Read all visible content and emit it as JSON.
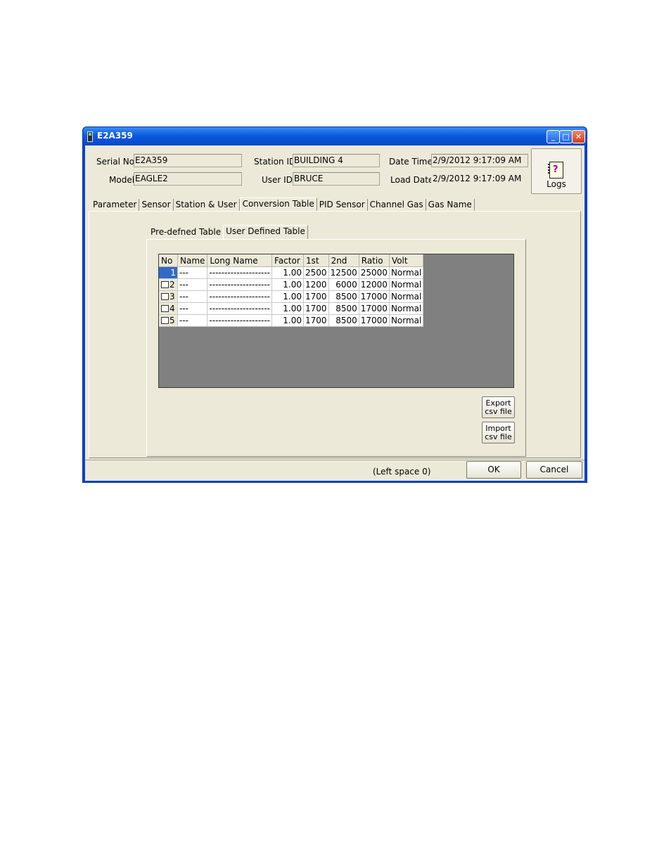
{
  "window": {
    "title": "E2A359"
  },
  "header": {
    "serial_label": "Serial No.",
    "serial_value": "E2A359",
    "model_label": "Model",
    "model_value": "EAGLE2",
    "station_label": "Station ID",
    "station_value": "BUILDING 4",
    "user_label": "User ID",
    "user_value": "BRUCE",
    "datetime_label": "Date Time",
    "datetime_value": "2/9/2012 9:17:09 AM",
    "loaddate_label": "Load Date",
    "loaddate_value": "2/9/2012 9:17:09 AM",
    "logs_label": "Logs"
  },
  "tabs": [
    "Parameter",
    "Sensor",
    "Station & User",
    "Conversion Table",
    "PID Sensor",
    "Channel Gas",
    "Gas Name"
  ],
  "active_tab": "Conversion Table",
  "subtabs": [
    "Pre-defned Table",
    "User Defined Table"
  ],
  "active_subtab": "User Defined Table",
  "table": {
    "columns": [
      "No",
      "Name",
      "Long Name",
      "Factor",
      "1st",
      "2nd",
      "Ratio",
      "Volt"
    ],
    "rows": [
      {
        "no": "1",
        "name": "---",
        "long_name": "--------------------",
        "factor": "1.00",
        "first": "2500",
        "second": "12500",
        "ratio": "25000",
        "volt": "Normal"
      },
      {
        "no": "2",
        "name": "---",
        "long_name": "--------------------",
        "factor": "1.00",
        "first": "1200",
        "second": "6000",
        "ratio": "12000",
        "volt": "Normal"
      },
      {
        "no": "3",
        "name": "---",
        "long_name": "--------------------",
        "factor": "1.00",
        "first": "1700",
        "second": "8500",
        "ratio": "17000",
        "volt": "Normal"
      },
      {
        "no": "4",
        "name": "---",
        "long_name": "--------------------",
        "factor": "1.00",
        "first": "1700",
        "second": "8500",
        "ratio": "17000",
        "volt": "Normal"
      },
      {
        "no": "5",
        "name": "---",
        "long_name": "--------------------",
        "factor": "1.00",
        "first": "1700",
        "second": "8500",
        "ratio": "17000",
        "volt": "Normal"
      }
    ]
  },
  "buttons": {
    "export_line1": "Export",
    "export_line2": "csv file",
    "import_line1": "Import",
    "import_line2": "csv file",
    "ok": "OK",
    "cancel": "Cancel"
  },
  "status": {
    "left_space": "(Left space 0)"
  },
  "icons": {
    "app": "instrument-icon",
    "logs": "notebook-icon",
    "minimize": "minimize-icon",
    "maximize": "maximize-icon",
    "close": "close-icon"
  },
  "colors": {
    "titlebar": "#0a5be0",
    "window_bg": "#ece9d8",
    "grid_bg": "#808080",
    "selection": "#316ac5"
  }
}
